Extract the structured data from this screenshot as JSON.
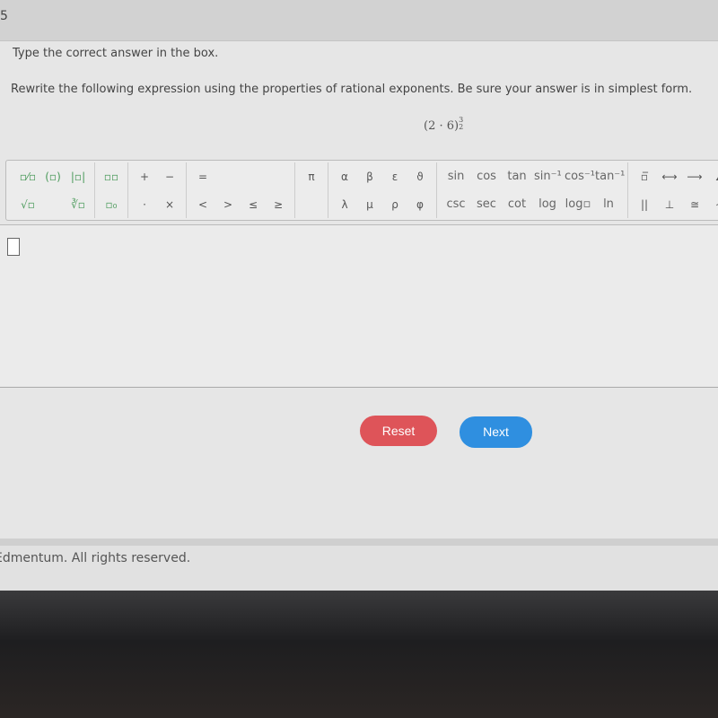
{
  "header": {
    "question_number": "5"
  },
  "question": {
    "instruction": "Type the correct answer in the box.",
    "prompt": "Rewrite the following expression using the properties of rational exponents. Be sure your answer is in simplest form.",
    "expression_base": "(2 · 6)",
    "exponent_numerator": "3",
    "exponent_denominator": "2"
  },
  "toolbar": {
    "groups": [
      [
        "▫⁄▫",
        "√▫",
        "(▫)",
        "",
        "|▫|",
        "∛▫"
      ],
      [
        "▫▫",
        "▫₀"
      ],
      [
        "+",
        "·",
        "−",
        "×"
      ],
      [
        "=",
        "<",
        "",
        ">",
        "",
        "≤",
        "",
        "≥"
      ],
      [
        "π",
        ""
      ],
      [
        "α",
        "λ",
        "β",
        "μ",
        "ε",
        "ρ",
        "ϑ",
        "φ"
      ],
      [
        "sin",
        "csc",
        "cos",
        "sec",
        "tan",
        "cot",
        "sin⁻¹",
        "log",
        "cos⁻¹",
        "log▫",
        "tan⁻¹",
        "ln"
      ],
      [
        "▫̅",
        "||",
        "⟷",
        "⊥",
        "⟶",
        "≅",
        "∠",
        "∼"
      ]
    ]
  },
  "answer": {
    "value": ""
  },
  "buttons": {
    "reset": "Reset",
    "next": "Next"
  },
  "colors": {
    "reset": "#de5459",
    "next": "#2f8fe0"
  },
  "footer": {
    "copyright": "Edmentum. All rights reserved."
  }
}
